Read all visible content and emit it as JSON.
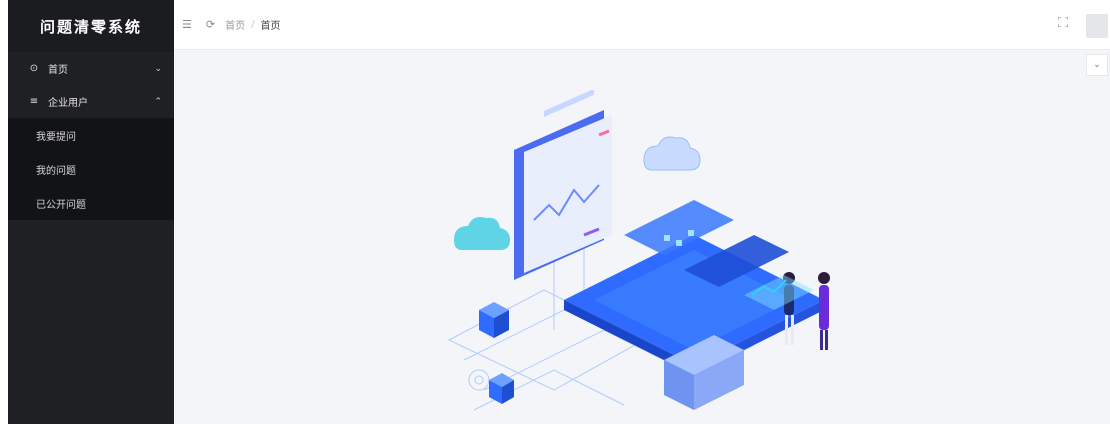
{
  "app": {
    "title": "问题清零系统"
  },
  "sidebar": {
    "items": [
      {
        "label": "首页",
        "icon": "dashboard-icon",
        "expanded": false
      },
      {
        "label": "企业用户",
        "icon": "menu-list-icon",
        "expanded": true,
        "children": [
          {
            "label": "我要提问"
          },
          {
            "label": "我的问题"
          },
          {
            "label": "已公开问题"
          }
        ]
      }
    ]
  },
  "header": {
    "breadcrumb": [
      "首页",
      "首页"
    ],
    "icons": [
      "hamburger-fold-icon",
      "refresh-icon",
      "fullscreen-icon"
    ]
  },
  "colors": {
    "sidebar_bg": "#1f2024",
    "submenu_bg": "#121316",
    "main_bg": "#f3f5f8",
    "accent_blue": "#2f6bff"
  }
}
